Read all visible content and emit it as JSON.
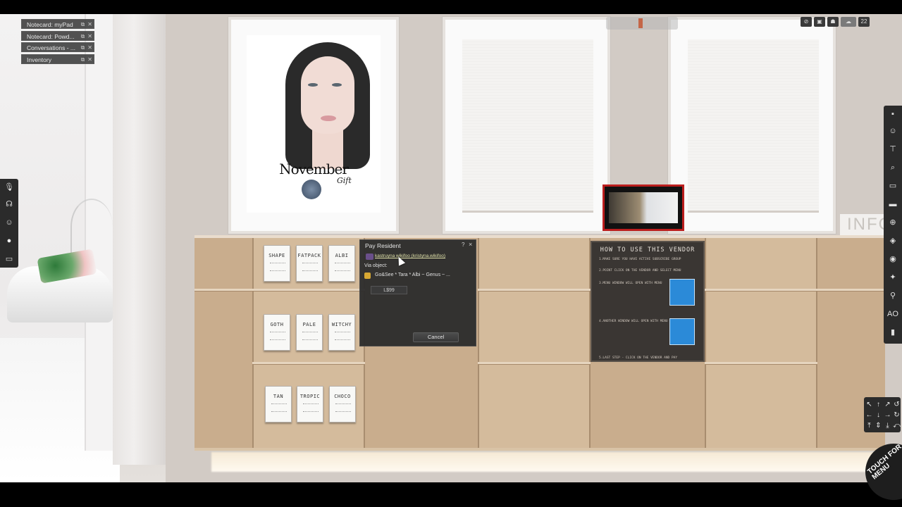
{
  "nearby_tabs": [
    {
      "label": "Notecard: myPad"
    },
    {
      "label": "Notecard: Powd..."
    },
    {
      "label": "Conversations - ..."
    },
    {
      "label": "Inventory"
    }
  ],
  "poster": {
    "title": "November",
    "subtitle": "Gift"
  },
  "vendor_cards": {
    "row1": [
      "SHAPE",
      "FATPACK",
      "ALBI"
    ],
    "row2": [
      "GOTH",
      "PALE",
      "WITCHY"
    ],
    "row3": [
      "TAN",
      "TROPIC",
      "CHOCO"
    ]
  },
  "vendor_board": {
    "heading": "HOW TO USE THIS VENDOR",
    "step1": "1.MAKE SURE YOU HAVE ACTIVE SUBSCRIBE GROUP",
    "step2": "2.POINT CLICK ON THE VENDOR AND SELECT MENU",
    "step3": "3.MENU WINDOW WILL OPEN WITH MENU",
    "step4": "4.ANOTHER WINDOW WILL OPEN WITH MENU",
    "step5": "5.LAST STEP - CLICK ON THE VENDOR AND PAY"
  },
  "info_sign": "INFO",
  "pay_dialog": {
    "title": "Pay Resident",
    "help": "?",
    "close": "×",
    "resident": "kastruyna wikifoo (kristyna.wikifoo)",
    "via_label": "Via object:",
    "object_name": "Go&See * Tara * Albi ~ Genus ~ ...",
    "amount": "L$99",
    "cancel_label": "Cancel"
  },
  "top_right_icons": [
    "lock-icon",
    "snapshot-icon",
    "people-icon",
    "cloud-icon",
    "fps-badge"
  ],
  "fps_value": "22",
  "left_toolbar": [
    "microphone-icon",
    "headset-icon",
    "people-icon",
    "chat-icon",
    "conversations-icon"
  ],
  "right_toolbar": [
    "lock-icon",
    "avatar-icon",
    "walk-icon",
    "search-icon",
    "camera-icon",
    "snapshot-icon",
    "map-icon",
    "build-icon",
    "eye-icon",
    "run-icon",
    "pose-icon",
    "ao-icon",
    "inventory-icon"
  ],
  "movepad_keys": [
    "↖",
    "↑",
    "↗",
    "↺",
    "←",
    "↓",
    "→",
    "↻",
    "⤒",
    "⇕",
    "⤓",
    "⤺"
  ],
  "touch_badge": "TOUCH FOR MENU"
}
